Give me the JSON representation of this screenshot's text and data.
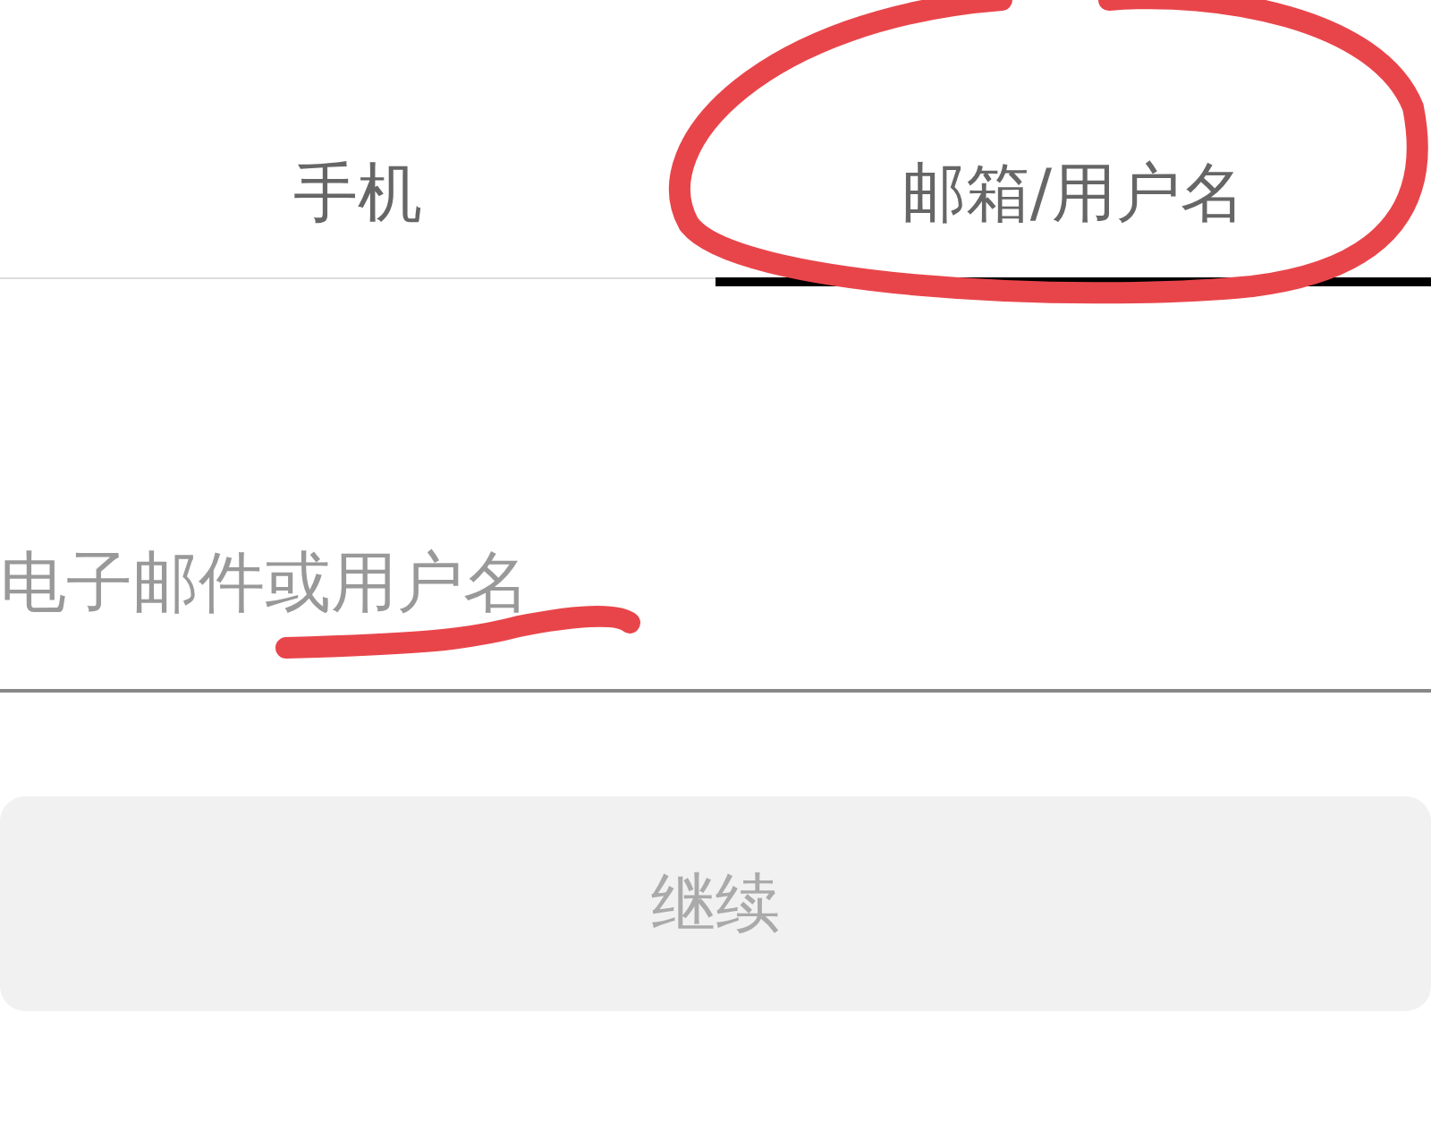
{
  "tabs": [
    {
      "label": "手机",
      "selected": false
    },
    {
      "label": "邮箱/用户名",
      "selected": true
    }
  ],
  "account_field": {
    "placeholder": "电子邮件或用户名"
  },
  "continue_button": {
    "label": "继续",
    "disabled": true
  }
}
